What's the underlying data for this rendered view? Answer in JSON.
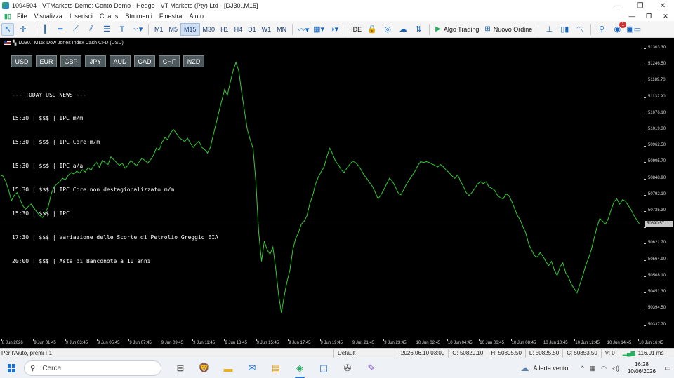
{
  "window": {
    "title": "1094504 - VTMarkets-Demo: Conto Demo - Hedge - VT Markets (Pty) Ltd - [DJ30.,M15]",
    "controls": [
      "—",
      "❐",
      "✕"
    ]
  },
  "menu": {
    "items": [
      "File",
      "Visualizza",
      "Inserisci",
      "Charts",
      "Strumenti",
      "Finestra",
      "Aiuto"
    ],
    "right": [
      "—",
      "❐",
      "✕"
    ]
  },
  "toolbar": {
    "timeframes": [
      "M1",
      "M5",
      "M15",
      "M30",
      "H1",
      "H4",
      "D1",
      "W1",
      "MN"
    ],
    "active_timeframe": "M15",
    "ide_label": "IDE",
    "algo_trading_label": "Algo Trading",
    "new_order_label": "Nuovo Ordine",
    "notification_count": "1"
  },
  "chart": {
    "title": "DJ30., M15: Dow Jones Index Cash CFD (USD)",
    "currency_buttons": [
      "USD",
      "EUR",
      "GBP",
      "JPY",
      "AUD",
      "CAD",
      "CHF",
      "NZD"
    ],
    "news_header": "--- TODAY USD NEWS ---",
    "news": [
      {
        "time": "15:30",
        "impact": "$$$",
        "event": "IPC m/m"
      },
      {
        "time": "15:30",
        "impact": "$$$",
        "event": "IPC Core m/m"
      },
      {
        "time": "15:30",
        "impact": "$$$",
        "event": "IPC a/a"
      },
      {
        "time": "15:30",
        "impact": "$$$",
        "event": "IPC Core non destagionalizzato m/m"
      },
      {
        "time": "15:30",
        "impact": "$$$",
        "event": "IPC"
      },
      {
        "time": "17:30",
        "impact": "$$$",
        "event": "Variazione delle Scorte di Petrolio Greggio EIA"
      },
      {
        "time": "20:00",
        "impact": "$$$",
        "event": "Asta di Banconote a 10 anni"
      }
    ],
    "line_color": "#32cd32",
    "background": "#000000",
    "current_price": "50690.57"
  },
  "chart_data": {
    "type": "line",
    "title": "DJ30., M15: Dow Jones Index Cash CFD (USD)",
    "xlabel": "",
    "ylabel": "",
    "ylim": [
      50290,
      51340
    ],
    "y_ticks": [
      51303.3,
      51246.5,
      51189.7,
      51132.9,
      51076.1,
      51019.3,
      50962.5,
      50905.7,
      50848.9,
      50792.1,
      50735.3,
      50678.5,
      50621.7,
      50564.9,
      50508.1,
      50451.3,
      50394.5,
      50337.7
    ],
    "x_ticks": [
      "8 Jun 2026",
      "9 Jun 01:45",
      "9 Jun 03:45",
      "9 Jun 05:45",
      "9 Jun 07:45",
      "9 Jun 09:45",
      "9 Jun 11:45",
      "9 Jun 13:45",
      "9 Jun 15:45",
      "9 Jun 17:45",
      "9 Jun 19:45",
      "9 Jun 21:45",
      "9 Jun 23:45",
      "10 Jun 02:45",
      "10 Jun 04:45",
      "10 Jun 06:45",
      "10 Jun 08:45",
      "10 Jun 10:45",
      "10 Jun 12:45",
      "10 Jun 14:45",
      "10 Jun 16:45"
    ],
    "current_price": 50690.57,
    "series": [
      {
        "values": [
          50862,
          50858,
          50840,
          50810,
          50772,
          50790,
          50800,
          50778,
          50755,
          50742,
          50752,
          50760,
          50745,
          50732,
          50720,
          50713,
          50730,
          50752,
          50795,
          50820,
          50830,
          50838,
          50850,
          50845,
          50860,
          50870,
          50865,
          50875,
          50868,
          50880,
          50872,
          50888,
          50878,
          50895,
          50905,
          50888,
          50912,
          50905,
          50898,
          50925,
          50915,
          50905,
          50895,
          50903,
          50885,
          50895,
          50912,
          50903,
          50893,
          50908,
          50920,
          50912,
          50903,
          50915,
          50930,
          50955,
          50948,
          50975,
          50992,
          50985,
          51008,
          51020,
          51008,
          50992,
          50985,
          50978,
          50990,
          50972,
          50958,
          50970,
          50980,
          50958,
          50950,
          50938,
          50958,
          51000,
          51040,
          51082,
          51120,
          51160,
          51140,
          51185,
          51225,
          51255,
          51225,
          51150,
          51085,
          51020,
          50985,
          50955,
          50840,
          50665,
          50560,
          50630,
          50600,
          50585,
          50610,
          50535,
          50445,
          50380,
          50440,
          50490,
          50530,
          50600,
          50640,
          50660,
          50690,
          50700,
          50720,
          50762,
          50790,
          50830,
          50855,
          50873,
          50890,
          50925,
          50955,
          50935,
          50910,
          50898,
          50880,
          50870,
          50885,
          50898,
          50910,
          50905,
          50895,
          50880,
          50862,
          50850,
          50835,
          50822,
          50800,
          50778,
          50792,
          50810,
          50830,
          50850,
          50840,
          50822,
          50800,
          50792,
          50810,
          50830,
          50845,
          50860,
          50875,
          50895,
          50908,
          50905,
          50908,
          50905,
          50900,
          50895,
          50890,
          50898,
          50890,
          50878,
          50870,
          50858,
          50850,
          50862,
          50840,
          50822,
          50800,
          50790,
          50800,
          50815,
          50830,
          50838,
          50832,
          50838,
          50820,
          50815,
          50808,
          50790,
          50782,
          50778,
          50795,
          50790,
          50770,
          50745,
          50720,
          50705,
          50680,
          50658,
          50620,
          50600,
          50580,
          50575,
          50590,
          50578,
          50560,
          50545,
          50560,
          50530,
          50510,
          50540,
          50555,
          50520,
          50505,
          50480,
          50465,
          50450,
          50480,
          50510,
          50545,
          50570,
          50600,
          50640,
          50680,
          50710,
          50700,
          50690,
          50710,
          50740,
          50768,
          50778,
          50760,
          50775,
          50770,
          50755,
          50740,
          50720,
          50705,
          50690
        ]
      }
    ],
    "grid": false,
    "legend": "none"
  },
  "statusbar": {
    "help": "Per l'Aiuto, premi F1",
    "profile": "Default",
    "datetime": "2026.06.10 03:00",
    "open": "O: 50829.10",
    "high": "H: 50895.50",
    "low": "L: 50825.50",
    "close": "C: 50853.50",
    "volume": "V: 0",
    "ping": "116.91 ms"
  },
  "taskbar": {
    "search_placeholder": "Cerca",
    "weather": "Allerta vento",
    "time": "16:28",
    "date": "10/06/2026"
  },
  "colors": {
    "accent": "#1565c0",
    "green": "#27ae60",
    "price_line": "#32cd32",
    "button_bg": "#4e5a5e"
  }
}
